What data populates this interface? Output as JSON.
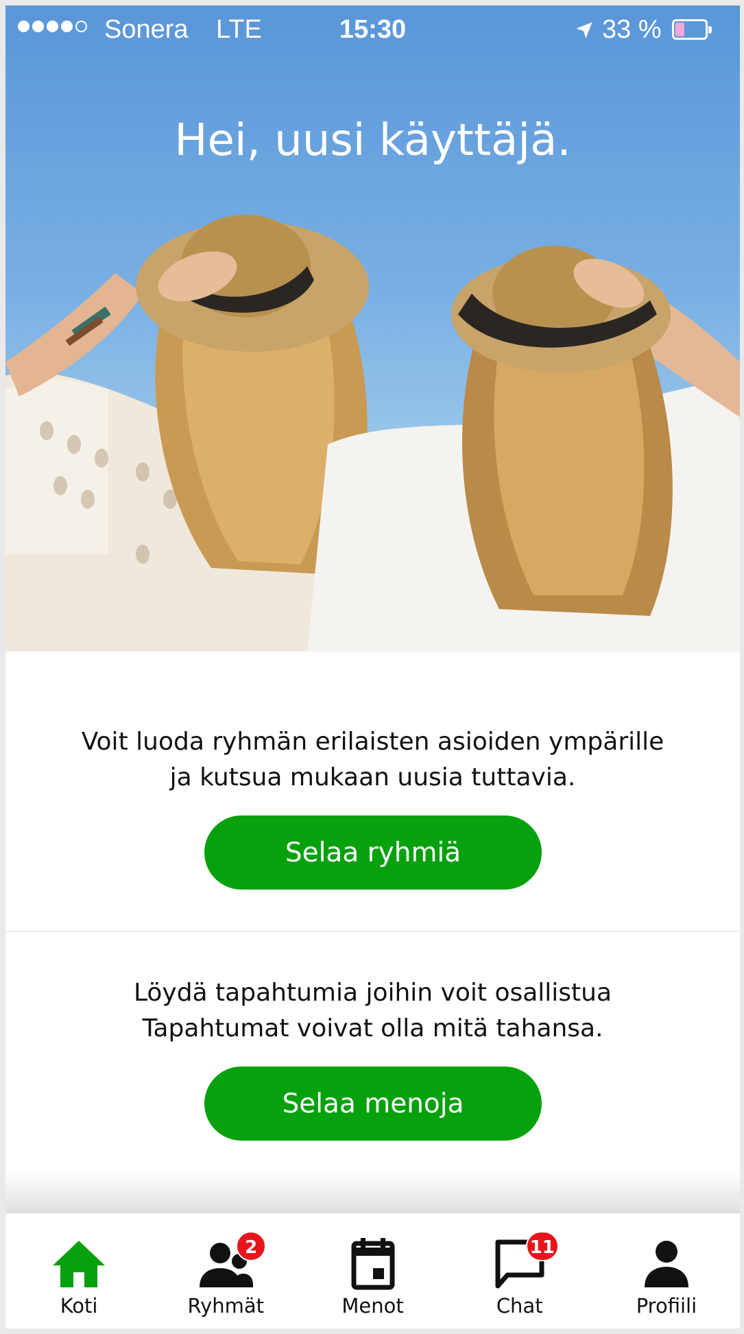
{
  "status_bar": {
    "carrier": "Sonera",
    "network": "LTE",
    "time": "15:30",
    "battery": "33 %",
    "battery_level": 0.33,
    "signal_bars": 4,
    "signal_max": 5
  },
  "hero": {
    "title": "Hei, uusi käyttäjä."
  },
  "groups_section": {
    "text_line1": "Voit luoda ryhmän erilaisten asioiden ympärille",
    "text_line2": "ja kutsua mukaan uusia tuttavia.",
    "button_label": "Selaa ryhmiä"
  },
  "events_section": {
    "text_line1": "Löydä tapahtumia joihin voit osallistua",
    "text_line2": "Tapahtumat voivat olla mitä tahansa.",
    "button_label": "Selaa menoja"
  },
  "tab_bar": {
    "tabs": [
      {
        "label": "Koti",
        "icon": "home-icon",
        "active": true
      },
      {
        "label": "Ryhmät",
        "icon": "group-icon",
        "badge": "2"
      },
      {
        "label": "Menot",
        "icon": "calendar-icon"
      },
      {
        "label": "Chat",
        "icon": "chat-icon",
        "badge": "11"
      },
      {
        "label": "Profiili",
        "icon": "person-icon"
      }
    ]
  },
  "colors": {
    "accent": "#06a10d",
    "badge": "#e8141c",
    "sky": "#6aa6de"
  }
}
